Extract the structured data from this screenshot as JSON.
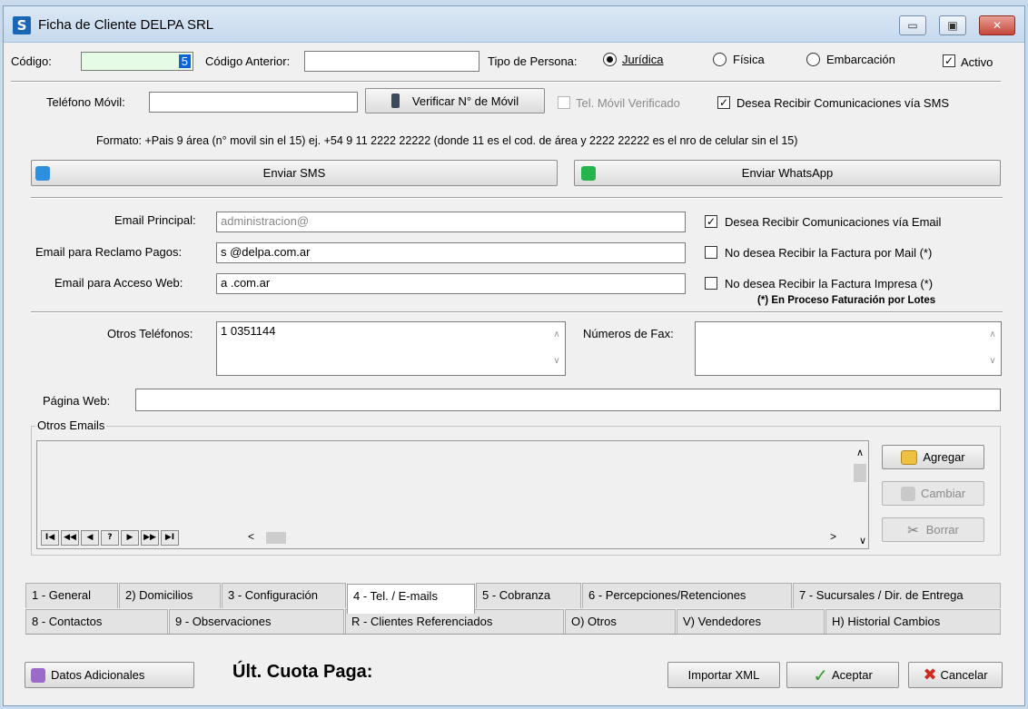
{
  "window": {
    "title": "Ficha de Cliente DELPA SRL",
    "minimize": "▭",
    "maximize": "▣",
    "close": "✕"
  },
  "header": {
    "codigo_label": "Código:",
    "codigo_value": "5",
    "codigo_anterior_label": "Código Anterior:",
    "codigo_anterior_value": "",
    "tipo_persona_label": "Tipo de Persona:",
    "tipo_options": [
      "Jurídica",
      "Física",
      "Embarcación"
    ],
    "tipo_selected": "Jurídica",
    "activo_label": "Activo",
    "activo_checked": true
  },
  "mobile": {
    "label": "Teléfono Móvil:",
    "value": "",
    "verify_button": "Verificar N° de Móvil",
    "verified_label": "Tel. Móvil Verificado",
    "sms_label": "Desea Recibir Comunicaciones vía SMS",
    "sms_checked": true,
    "format_text": "Formato: +Pais 9 área (n° movil sin el 15) ej.  +54 9 11 2222 22222 (donde 11 es el cod. de área y  2222 22222 es el nro de celular sin el 15)",
    "send_sms": "Enviar SMS",
    "send_whatsapp": "Enviar WhatsApp"
  },
  "emails": {
    "principal_label": "Email Principal:",
    "principal_value": "administracion@",
    "reclamo_label": "Email para Reclamo Pagos:",
    "reclamo_value": "s  @delpa.com.ar",
    "acceso_label": "Email para Acceso Web:",
    "acceso_value": "a  .com.ar",
    "opt_email_label": "Desea Recibir Comunicaciones vía Email",
    "opt_email_checked": true,
    "opt_factura_mail_label": "No desea Recibir la Factura por Mail (*)",
    "opt_factura_impresa_label": "No desea Recibir la Factura Impresa (*)",
    "footnote": "(*)  En Proceso Faturación por Lotes"
  },
  "phones": {
    "otros_label": "Otros Teléfonos:",
    "otros_value": "1  0351144",
    "fax_label": "Números de Fax:",
    "fax_value": "",
    "web_label": "Página Web:",
    "web_value": ""
  },
  "otros_emails": {
    "legend": "Otros Emails",
    "nav": [
      "I◀",
      "◀◀",
      "◀",
      "?",
      "▶",
      "▶▶",
      "▶I"
    ],
    "agregar": "Agregar",
    "cambiar": "Cambiar",
    "borrar": "Borrar"
  },
  "tabs_row1": [
    "1 - General",
    "2) Domicilios",
    "3 - Configuración",
    "4 - Tel. / E-mails",
    "5 - Cobranza",
    "6 - Percepciones/Retenciones",
    "7 - Sucursales / Dir. de Entrega"
  ],
  "tabs_row2": [
    "8 - Contactos",
    "9 - Observaciones",
    "R - Clientes Referenciados",
    "O) Otros",
    "V) Vendedores",
    "H) Historial Cambios"
  ],
  "active_tab": "4 - Tel. / E-mails",
  "footer": {
    "datos_adicionales": "Datos Adicionales",
    "ult_cuota": "Últ. Cuota Paga:",
    "importar_xml": "Importar XML",
    "aceptar": "Aceptar",
    "cancelar": "Cancelar"
  },
  "colors": {
    "accent": "#1a67b5",
    "codigo_field_bg": "#e6fbe6",
    "selection": "#0a64d8"
  }
}
